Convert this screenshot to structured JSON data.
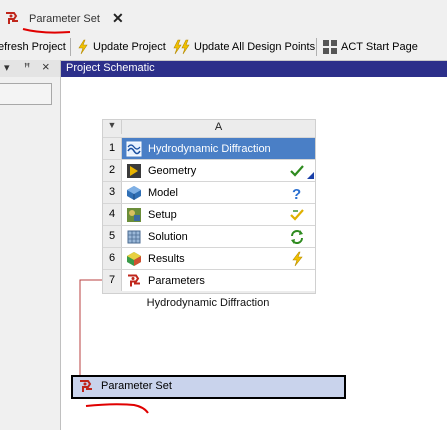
{
  "tab": {
    "label": "Parameter Set",
    "close_label": "✕"
  },
  "toolbar": {
    "refresh_label": "efresh Project",
    "update_label": "Update Project",
    "update_all_label": "Update All Design Points",
    "act_label": "ACT Start Page"
  },
  "left_panel": {
    "dropdown": "▾",
    "pin": "ꟸ",
    "close": "×"
  },
  "schematic": {
    "title": "Project Schematic",
    "column_label": "A",
    "column_arrow": "▼",
    "rows": [
      {
        "num": "1",
        "label": "Hydrodynamic Diffraction",
        "icon": "hydrodynamic-diffraction-icon",
        "status": ""
      },
      {
        "num": "2",
        "label": "Geometry",
        "icon": "geometry-icon",
        "status": "up-to-date-checkmark"
      },
      {
        "num": "3",
        "label": "Model",
        "icon": "model-icon",
        "status": "unfulfilled-question"
      },
      {
        "num": "4",
        "label": "Setup",
        "icon": "setup-icon",
        "status": "attention-check"
      },
      {
        "num": "5",
        "label": "Solution",
        "icon": "solution-icon",
        "status": "refresh-required"
      },
      {
        "num": "6",
        "label": "Results",
        "icon": "results-icon",
        "status": "update-required"
      },
      {
        "num": "7",
        "label": "Parameters",
        "icon": "parameters-icon",
        "status": ""
      }
    ],
    "system_caption": "Hydrodynamic Diffraction"
  },
  "parameter_set": {
    "label": "Parameter Set"
  },
  "colors": {
    "header_bg": "#2c2f8a",
    "selected_row": "#4a7fc6",
    "parameter_bar": "#c9d3ec",
    "annotation": "#e00000"
  }
}
